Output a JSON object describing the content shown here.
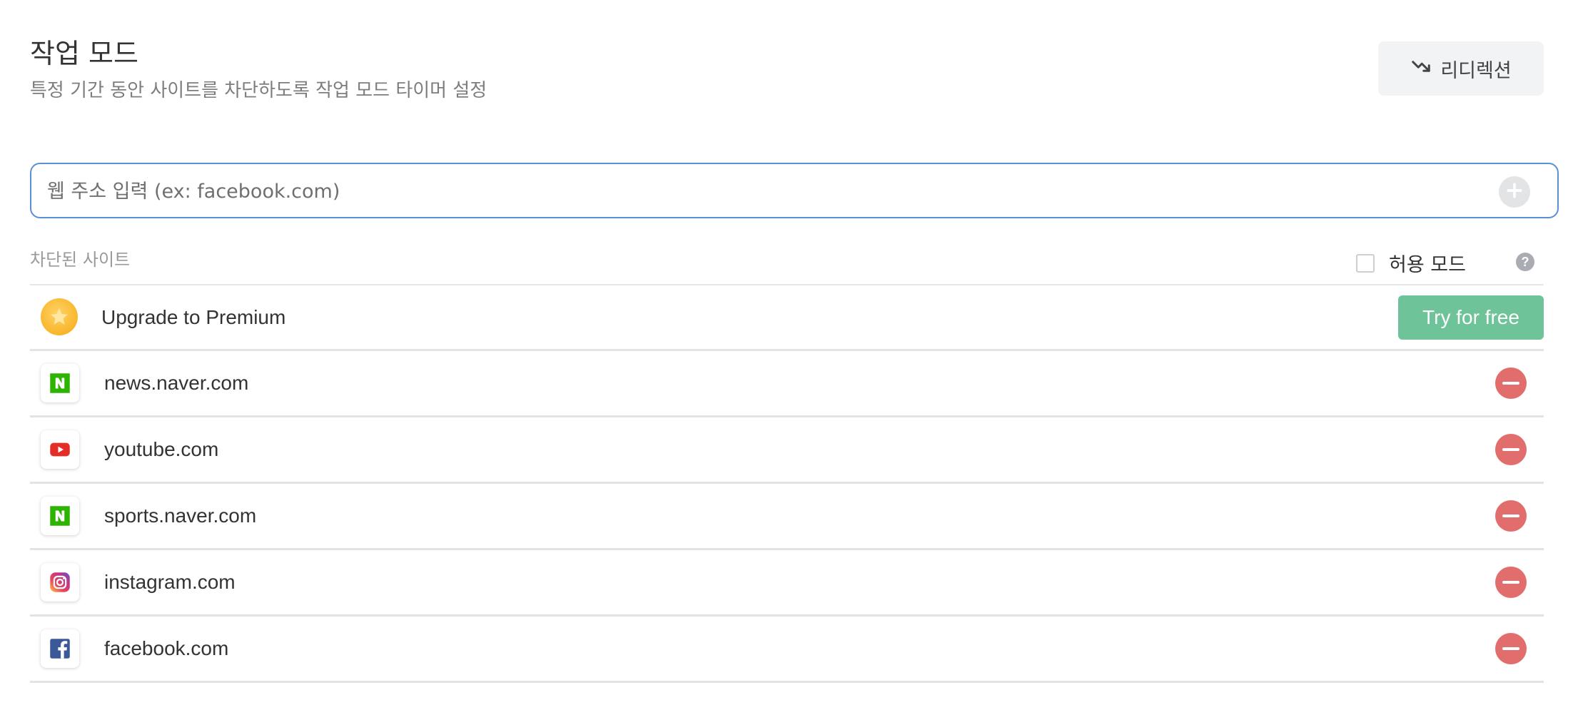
{
  "header": {
    "title": "작업 모드",
    "subtitle": "특정 기간 동안 사이트를 차단하도록 작업 모드 타이머 설정",
    "redirect_label": "리디렉션"
  },
  "url_input": {
    "placeholder": "웹 주소 입력 (ex: facebook.com)",
    "value": ""
  },
  "list": {
    "label": "차단된 사이트",
    "allow_mode_label": "허용 모드",
    "allow_mode_checked": false,
    "help_icon": "?"
  },
  "premium": {
    "text": "Upgrade to Premium",
    "button_label": "Try for free",
    "button_color": "#6ec498"
  },
  "sites": [
    {
      "name": "news.naver.com",
      "icon": "naver-icon"
    },
    {
      "name": "youtube.com",
      "icon": "youtube-icon"
    },
    {
      "name": "sports.naver.com",
      "icon": "naver-icon"
    },
    {
      "name": "instagram.com",
      "icon": "instagram-icon"
    },
    {
      "name": "facebook.com",
      "icon": "facebook-icon"
    }
  ],
  "colors": {
    "input_border": "#5b8fd6",
    "remove": "#e26d6d",
    "naver": "#2db400",
    "youtube": "#e52d27",
    "facebook": "#3b5998"
  }
}
